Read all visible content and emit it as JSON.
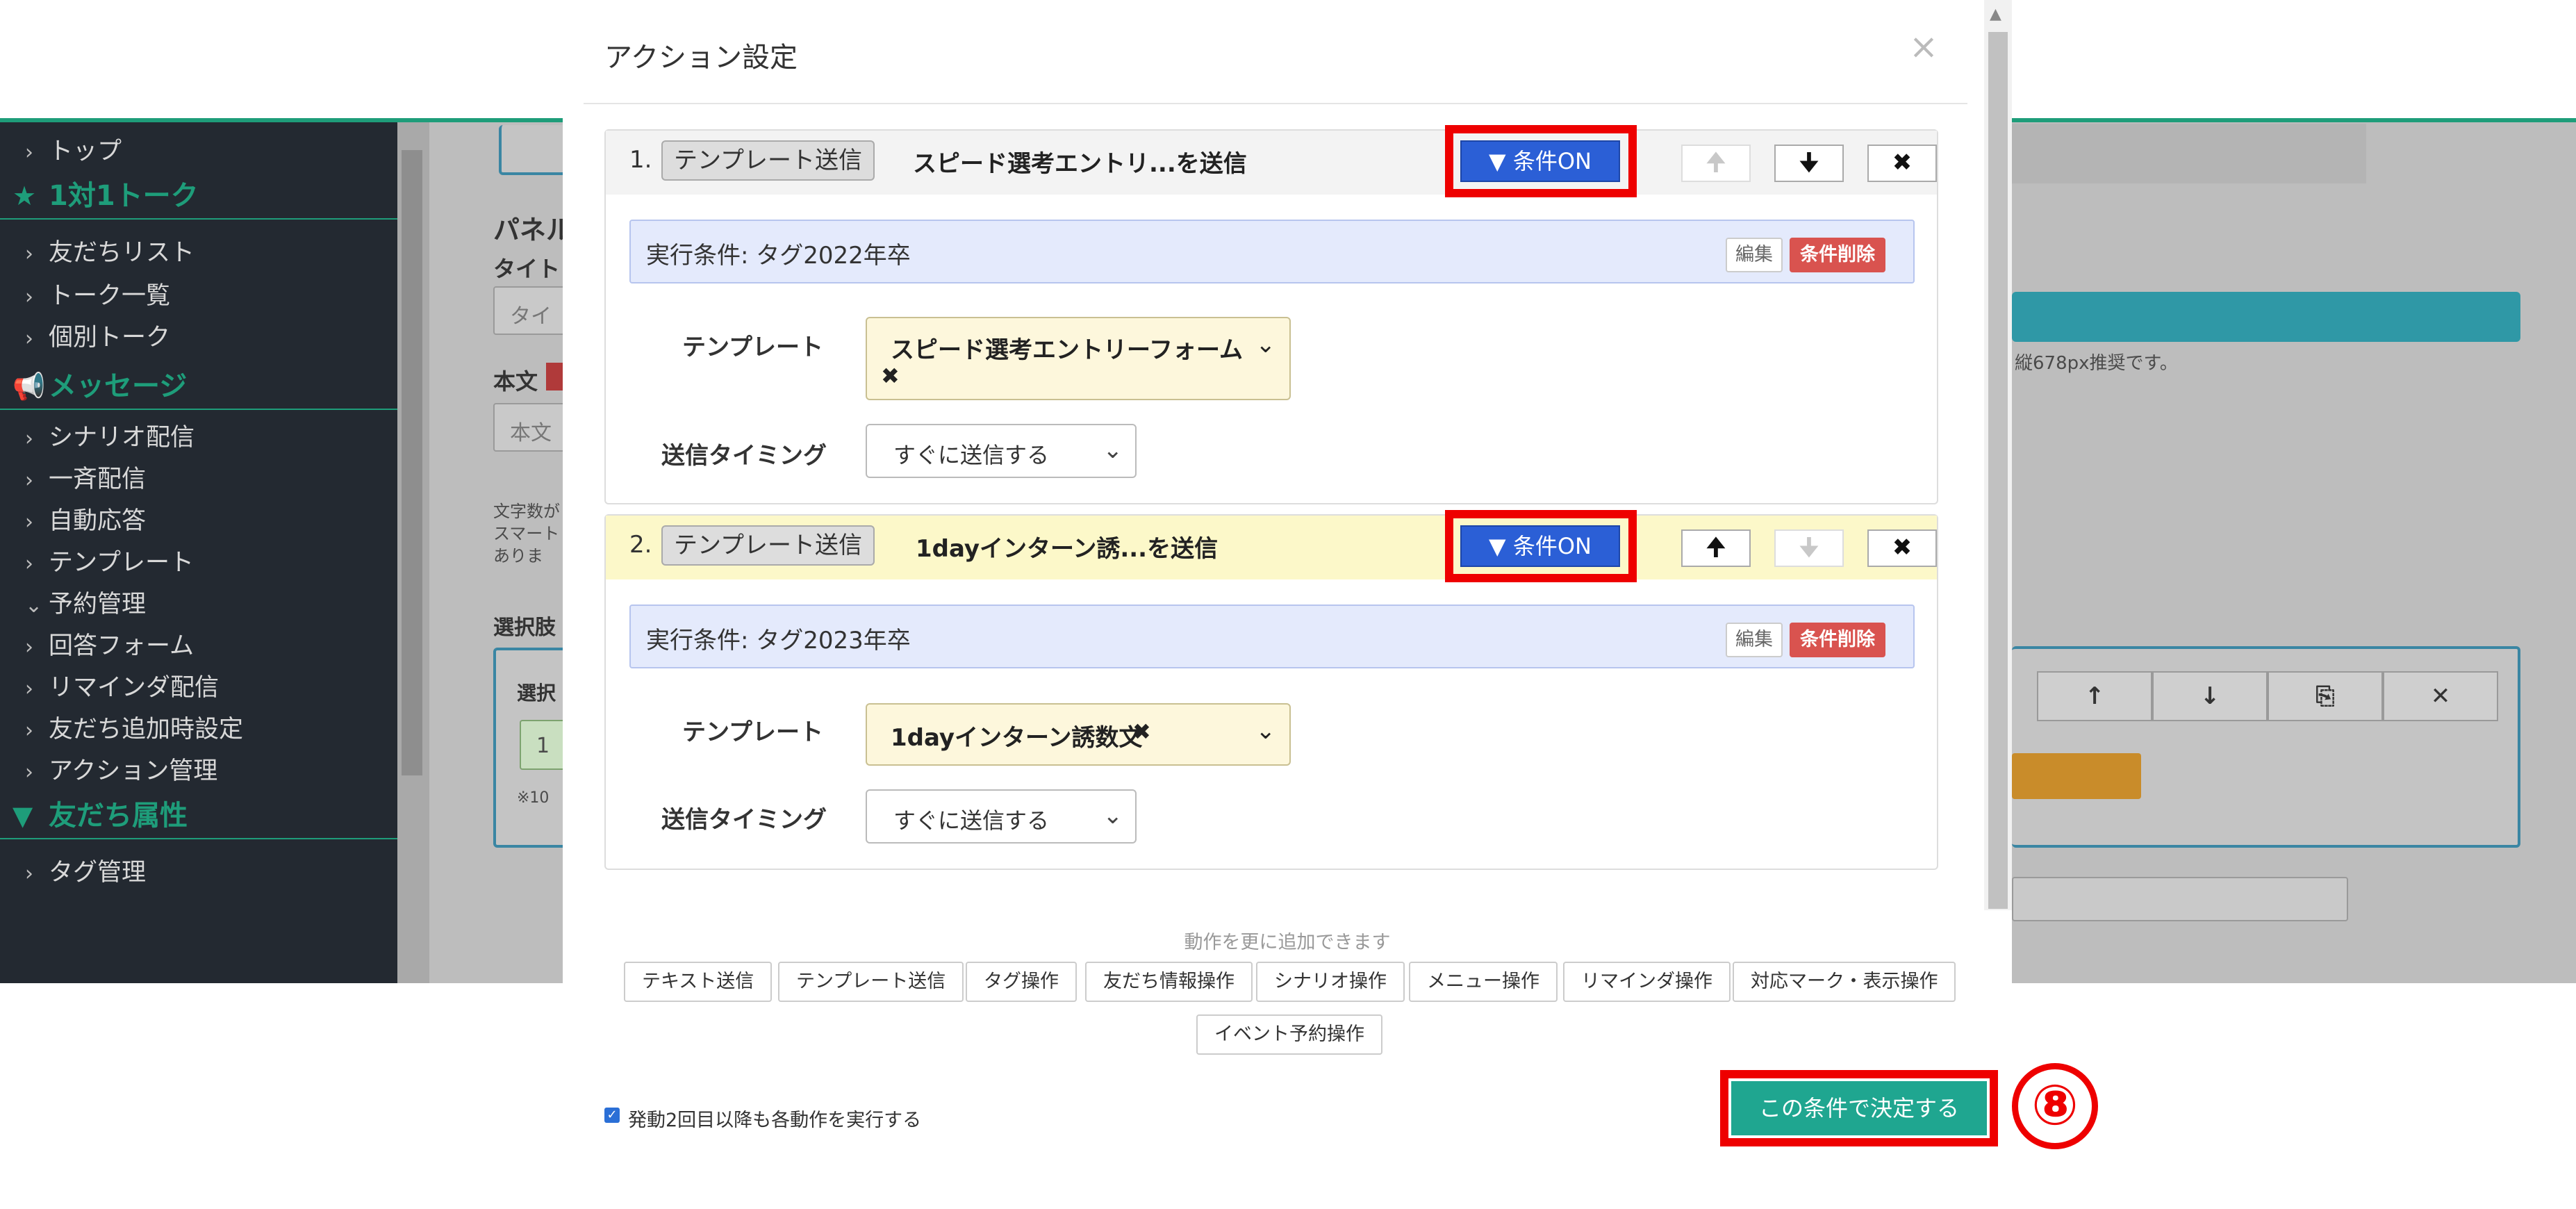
{
  "background": {
    "sidebar": {
      "items": [
        {
          "type": "item",
          "label": "トップ"
        },
        {
          "type": "header",
          "icon": "star-icon",
          "label": "1対1トーク"
        },
        {
          "type": "item",
          "label": "友だちリスト"
        },
        {
          "type": "item",
          "label": "トーク一覧"
        },
        {
          "type": "item",
          "label": "個別トーク"
        },
        {
          "type": "header",
          "icon": "megaphone-icon",
          "label": "メッセージ"
        },
        {
          "type": "item",
          "label": "シナリオ配信"
        },
        {
          "type": "item",
          "label": "一斉配信"
        },
        {
          "type": "item",
          "label": "自動応答"
        },
        {
          "type": "item",
          "label": "テンプレート"
        },
        {
          "type": "item-open",
          "label": "予約管理"
        },
        {
          "type": "item",
          "label": "回答フォーム"
        },
        {
          "type": "item",
          "label": "リマインダ配信"
        },
        {
          "type": "item",
          "label": "友だち追加時設定"
        },
        {
          "type": "item",
          "label": "アクション管理"
        },
        {
          "type": "header",
          "icon": "filter-icon",
          "label": "友だち属性"
        },
        {
          "type": "item",
          "label": "タグ管理"
        }
      ]
    },
    "main": {
      "panel_label": "パネル",
      "title_label": "タイト",
      "title_placeholder": "タイ",
      "body_label": "本文",
      "body_placeholder": "本文",
      "note_lines": [
        "文字数が",
        "スマート",
        "ありま"
      ],
      "choices_label": "選択肢",
      "choice_label": "選択",
      "choice_value": "1",
      "choice_note": "※10",
      "size_note": "縦678px推奨です。"
    }
  },
  "modal": {
    "title": "アクション設定",
    "close": "×",
    "actions": [
      {
        "number": "1.",
        "tag": "テンプレート送信",
        "description": "スピード選考エントリ...を送信",
        "condition_button": "条件ON",
        "up": "🠉",
        "down": "🠋",
        "remove": "✖",
        "condition_text": "実行条件: タグ2022年卒",
        "edit": "編集",
        "delete_condition": "条件削除",
        "template_label": "テンプレート",
        "template_value": "スピード選考エントリーフォーム",
        "template_remove": "✖",
        "timing_label": "送信タイミング",
        "timing_value": "すぐに送信する"
      },
      {
        "number": "2.",
        "tag": "テンプレート送信",
        "description": "1dayインターン誘...を送信",
        "condition_button": "条件ON",
        "up": "🠉",
        "down": "🠋",
        "remove": "✖",
        "condition_text": "実行条件: タグ2023年卒",
        "edit": "編集",
        "delete_condition": "条件削除",
        "template_label": "テンプレート",
        "template_value": "1dayインターン誘数文",
        "template_remove": "✖",
        "timing_label": "送信タイミング",
        "timing_value": "すぐに送信する"
      }
    ],
    "add_note": "動作を更に追加できます",
    "add_buttons": [
      "テキスト送信",
      "テンプレート送信",
      "タグ操作",
      "友だち情報操作",
      "シナリオ操作",
      "メニュー操作",
      "リマインダ操作",
      "対応マーク・表示操作",
      "イベント予約操作"
    ],
    "repeat_checkbox": "発動2回目以降も各動作を実行する",
    "confirm_button": "この条件で決定する"
  },
  "step_marker": "⑧",
  "colors": {
    "highlight": "#ee0000",
    "condition_on": "#2b5fd6",
    "confirm": "#1fa690",
    "delete": "#d9534f",
    "sidebar_bg": "#232931",
    "brand_green": "#1e9d7a"
  }
}
